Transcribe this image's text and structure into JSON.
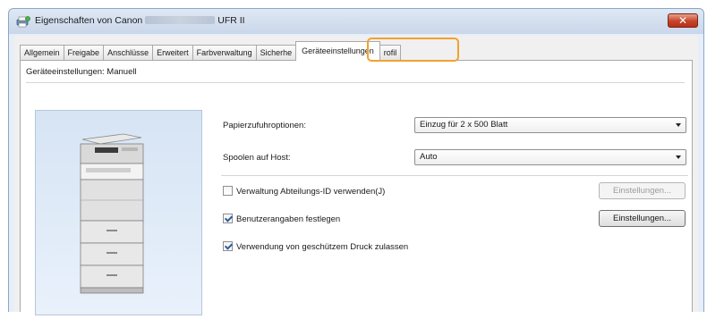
{
  "window": {
    "title_prefix": "Eigenschaften von Canon",
    "title_suffix": "UFR II",
    "close_glyph": "✕"
  },
  "tabs": [
    {
      "label": "Allgemein"
    },
    {
      "label": "Freigabe"
    },
    {
      "label": "Anschlüsse"
    },
    {
      "label": "Erweitert"
    },
    {
      "label": "Farbverwaltung"
    },
    {
      "label": "Sicherhe"
    },
    {
      "label": "Geräteeinstellungen",
      "active": true
    },
    {
      "label": "rofil"
    }
  ],
  "page": {
    "heading": "Geräteeinstellungen: Manuell"
  },
  "settings": {
    "paper_feed_label": "Papierzufuhroptionen:",
    "paper_feed_value": "Einzug für 2 x 500 Blatt",
    "spool_label": "Spoolen auf Host:",
    "spool_value": "Auto",
    "dept_id_label": "Verwaltung Abteilungs-ID verwenden(J)",
    "dept_id_checked": false,
    "dept_id_button": "Einstellungen...",
    "user_info_label": "Benutzerangaben festlegen",
    "user_info_checked": true,
    "user_info_button": "Einstellungen...",
    "secure_print_label": "Verwendung von geschützem Druck zulassen",
    "secure_print_checked": true
  },
  "colors": {
    "highlight": "#f2a12e",
    "close_button": "#c7432a"
  },
  "icons": {
    "title": "printer-properties-icon",
    "close": "close-icon",
    "dropdown": "chevron-down-icon"
  }
}
